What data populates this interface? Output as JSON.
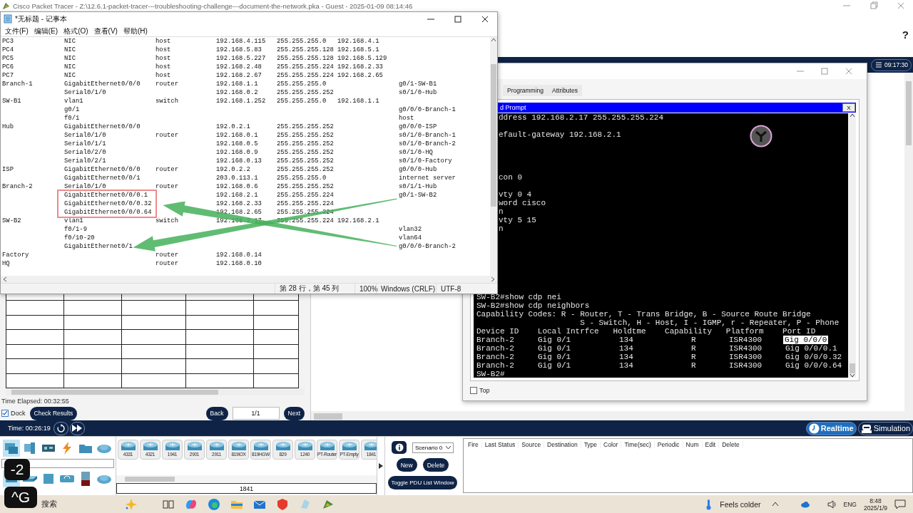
{
  "app": {
    "title": "Cisco Packet Tracer - Z:\\12.6.1-packet-tracer---troubleshooting-challenge---document-the-network.pka - Guest - 2025-01-09 08:14:46",
    "help": "?",
    "clock": "09:17:30"
  },
  "notepad": {
    "title": "*无标题 - 记事本",
    "menu": [
      "文件(F)",
      "编辑(E)",
      "格式(O)",
      "查看(V)",
      "帮助(H)"
    ],
    "rows": [
      {
        "device": "PC3",
        "interface": "NIC",
        "type": "host",
        "ip": "192.168.4.115",
        "mask": "255.255.255.0",
        "gateway": "192.168.4.1",
        "boxed": false
      },
      {
        "device": "PC4",
        "interface": "NIC",
        "type": "host",
        "ip": "192.168.5.83",
        "mask": "255.255.255.128",
        "gateway": "192.168.5.1",
        "boxed": false
      },
      {
        "device": "PC5",
        "interface": "NIC",
        "type": "host",
        "ip": "192.168.5.227",
        "mask": "255.255.255.128",
        "gateway": "192.168.5.129",
        "boxed": false
      },
      {
        "device": "PC6",
        "interface": "NIC",
        "type": "host",
        "ip": "192.168.2.48",
        "mask": "255.255.255.224",
        "gateway": "192.168.2.33",
        "boxed": false
      },
      {
        "device": "PC7",
        "interface": "NIC",
        "type": "host",
        "ip": "192.168.2.67",
        "mask": "255.255.255.224",
        "gateway": "192.168.2.65",
        "boxed": false
      },
      {
        "device": "Branch-1",
        "interface": "GigabitEthernet0/0/0",
        "type": "router",
        "ip": "192.168.1.1",
        "mask": "255.255.255.0",
        "link": "g0/1-SW-B1",
        "boxed": false
      },
      {
        "interface": "Serial0/1/0",
        "ip": "192.168.0.2",
        "mask": "255.255.255.252",
        "link": "s0/1/0-Hub",
        "boxed": false
      },
      {
        "device": "SW-B1",
        "interface": "vlan1",
        "type": "switch",
        "ip": "192.168.1.252",
        "mask": "255.255.255.0",
        "gateway": "192.168.1.1",
        "boxed": false
      },
      {
        "interface": "g0/1",
        "link": "g0/0/0-Branch-1",
        "boxed": false
      },
      {
        "interface": "f0/1",
        "link": "host",
        "boxed": false
      },
      {
        "device": "Hub",
        "interface": "GigabitEthernet0/0/0",
        "ip": "192.0.2.1",
        "mask": "255.255.255.252",
        "link": "g0/0/0-ISP",
        "boxed": false
      },
      {
        "interface": "Serial0/1/0",
        "type": "router",
        "ip": "192.168.0.1",
        "mask": "255.255.255.252",
        "link": "s0/1/0-Branch-1",
        "boxed": false
      },
      {
        "interface": "Serial0/1/1",
        "ip": "192.168.0.5",
        "mask": "255.255.255.252",
        "link": "s0/1/0-Branch-2",
        "boxed": false
      },
      {
        "interface": "Serial0/2/0",
        "ip": "192.168.0.9",
        "mask": "255.255.255.252",
        "link": "s0/1/0-HQ",
        "boxed": false
      },
      {
        "interface": "Serial0/2/1",
        "ip": "192.168.0.13",
        "mask": "255.255.255.252",
        "link": "s0/1/0-Factory",
        "boxed": false
      },
      {
        "device": "ISP",
        "interface": "GigabitEthernet0/0/0",
        "type": "router",
        "ip": "192.0.2.2",
        "mask": "255.255.255.252",
        "link": "g0/0/0-Hub",
        "boxed": false
      },
      {
        "interface": "GigabitEthernet0/0/1",
        "ip": "203.0.113.1",
        "mask": "255.255.255.0",
        "link": "internet server",
        "boxed": false
      },
      {
        "device": "Branch-2",
        "interface": "Serial0/1/0",
        "type": "router",
        "ip": "192.168.0.6",
        "mask": "255.255.255.252",
        "link": "s0/1/1-Hub",
        "boxed": false
      },
      {
        "interface": "GigabitEthernet0/0/0.1",
        "ip": "192.168.2.1",
        "mask": "255.255.255.224",
        "link": "g0/1-SW-B2",
        "boxed": true
      },
      {
        "interface": "GigabitEthernet0/0/0.32",
        "ip": "192.168.2.33",
        "mask": "255.255.255.224",
        "boxed": true
      },
      {
        "interface": "GigabitEthernet0/0/0.64",
        "ip": "192.168.2.65",
        "mask": "255.255.255.224",
        "boxed": true
      },
      {
        "device": "SW-B2",
        "interface": "vlan1",
        "type": "switch",
        "ip": "192.168.2.17",
        "mask": "255.255.255.224",
        "gateway": "192.168.2.1",
        "boxed": false
      },
      {
        "interface": "f0/1-9",
        "link": "vlan32",
        "boxed": false
      },
      {
        "interface": "f0/10-20",
        "link": "vlan64",
        "boxed": false
      },
      {
        "interface": "GigabitEthernet0/1",
        "link": "g0/0/0-Branch-2",
        "boxed": false
      },
      {
        "device": "Factory",
        "type": "router",
        "ip": "192.168.0.14",
        "boxed": false
      },
      {
        "device": "HQ",
        "type": "router",
        "ip": "192.168.0.10",
        "boxed": false
      }
    ],
    "status": [
      "第 28 行，第 45 列",
      "100%",
      "Windows (CRLF)",
      "UTF-8"
    ]
  },
  "device_window": {
    "tabs": [
      {
        "label": "Programming",
        "selected": false
      },
      {
        "label": "Attributes",
        "selected": false
      }
    ],
    "prompt_title": "d Prompt",
    "prompt_close": "X",
    "lines": [
      {
        "kind": "cut",
        "text": "ddress 192.168.2.17 255.255.255.224"
      },
      {
        "kind": "blank"
      },
      {
        "kind": "cut",
        "text": "efault-gateway 192.168.2.1"
      },
      {
        "kind": "blank"
      },
      {
        "kind": "blank"
      },
      {
        "kind": "blank"
      },
      {
        "kind": "blank"
      },
      {
        "kind": "cut",
        "text": "con 0"
      },
      {
        "kind": "blank"
      },
      {
        "kind": "cut",
        "text": "vty 0 4"
      },
      {
        "kind": "cut",
        "text": "word cisco"
      },
      {
        "kind": "cut",
        "text": "n"
      },
      {
        "kind": "cut",
        "text": "vty 5 15"
      },
      {
        "kind": "cut",
        "text": "n"
      },
      {
        "kind": "blank"
      },
      {
        "kind": "blank"
      },
      {
        "kind": "blank"
      },
      {
        "kind": "blank"
      },
      {
        "kind": "blank"
      },
      {
        "kind": "blank"
      },
      {
        "kind": "blank"
      },
      {
        "kind": "full",
        "text": "SW-B2#show cdp nei"
      },
      {
        "kind": "full",
        "text": "SW-B2#show cdp neighbors"
      },
      {
        "kind": "full",
        "text": "Capability Codes: R - Router, T - Trans Bridge, B - Source Route Bridge"
      },
      {
        "kind": "continuation",
        "text": "S - Switch, H - Host, I - IGMP, r - Repeater, P - Phone"
      },
      {
        "kind": "full",
        "text": "Device ID    Local Intrfce   Holdtme    Capability   Platform    Port ID"
      }
    ],
    "cdp_rows": [
      {
        "device": "Branch-2",
        "local": "Gig 0/1",
        "holdtime": "134",
        "capability": "R",
        "platform": "ISR4300",
        "port": "Gig 0/0/0",
        "selected": true
      },
      {
        "device": "Branch-2",
        "local": "Gig 0/1",
        "holdtime": "134",
        "capability": "R",
        "platform": "ISR4300",
        "port": "Gig 0/0/0.1",
        "selected": false
      },
      {
        "device": "Branch-2",
        "local": "Gig 0/1",
        "holdtime": "134",
        "capability": "R",
        "platform": "ISR4300",
        "port": "Gig 0/0/0.32",
        "selected": false
      },
      {
        "device": "Branch-2",
        "local": "Gig 0/1",
        "holdtime": "134",
        "capability": "R",
        "platform": "ISR4300",
        "port": "Gig 0/0/0.64",
        "selected": false
      }
    ],
    "prompt": "SW-B2#",
    "top_checkbox": {
      "label": "Top",
      "checked": false
    }
  },
  "activity": {
    "time_elapsed": "Time Elapsed: 00:32:55",
    "dock": {
      "label": "Dock",
      "checked": true
    },
    "check_results": "Check Results",
    "back": "Back",
    "page": "1/1",
    "next": "Next"
  },
  "sim_bar": {
    "time": "Time: 00:26:19",
    "modes": [
      {
        "label": "Realtime",
        "selected": true
      },
      {
        "label": "Simulation",
        "selected": false
      }
    ]
  },
  "categories": [
    [
      {
        "kind": "network",
        "selected": true
      },
      {
        "kind": "end",
        "selected": false
      },
      {
        "kind": "component",
        "selected": false
      },
      {
        "kind": "connection",
        "selected": false
      },
      {
        "kind": "folder",
        "selected": false
      },
      {
        "kind": "cloud",
        "selected": false
      }
    ],
    [
      {
        "kind": "router",
        "selected": true
      },
      {
        "kind": "switch",
        "selected": false
      },
      {
        "kind": "hub",
        "selected": false
      },
      {
        "kind": "wireless",
        "selected": false
      },
      {
        "kind": "security",
        "selected": false
      },
      {
        "kind": "cloud",
        "selected": false
      }
    ]
  ],
  "models": [
    "4331",
    "4321",
    "1941",
    "2901",
    "2911",
    "819IOX",
    "819HGW",
    "829",
    "1240",
    "PT-Router",
    "PT-Empty",
    "1841"
  ],
  "model_name": "1841",
  "scenario": {
    "select": "Scenario 0",
    "new": "New",
    "delete": "Delete",
    "toggle": "Toggle PDU List Window"
  },
  "pdu_columns": [
    "Fire",
    "Last Status",
    "Source",
    "Destination",
    "Type",
    "Color",
    "Time(sec)",
    "Periodic",
    "Num",
    "Edit",
    "Delete"
  ],
  "taskbar": {
    "search": "搜索",
    "weather": "Feels colder",
    "lang": "ENG",
    "time": "8:48",
    "date": "2025/1/9"
  },
  "keycast": [
    "-2",
    "^G"
  ]
}
